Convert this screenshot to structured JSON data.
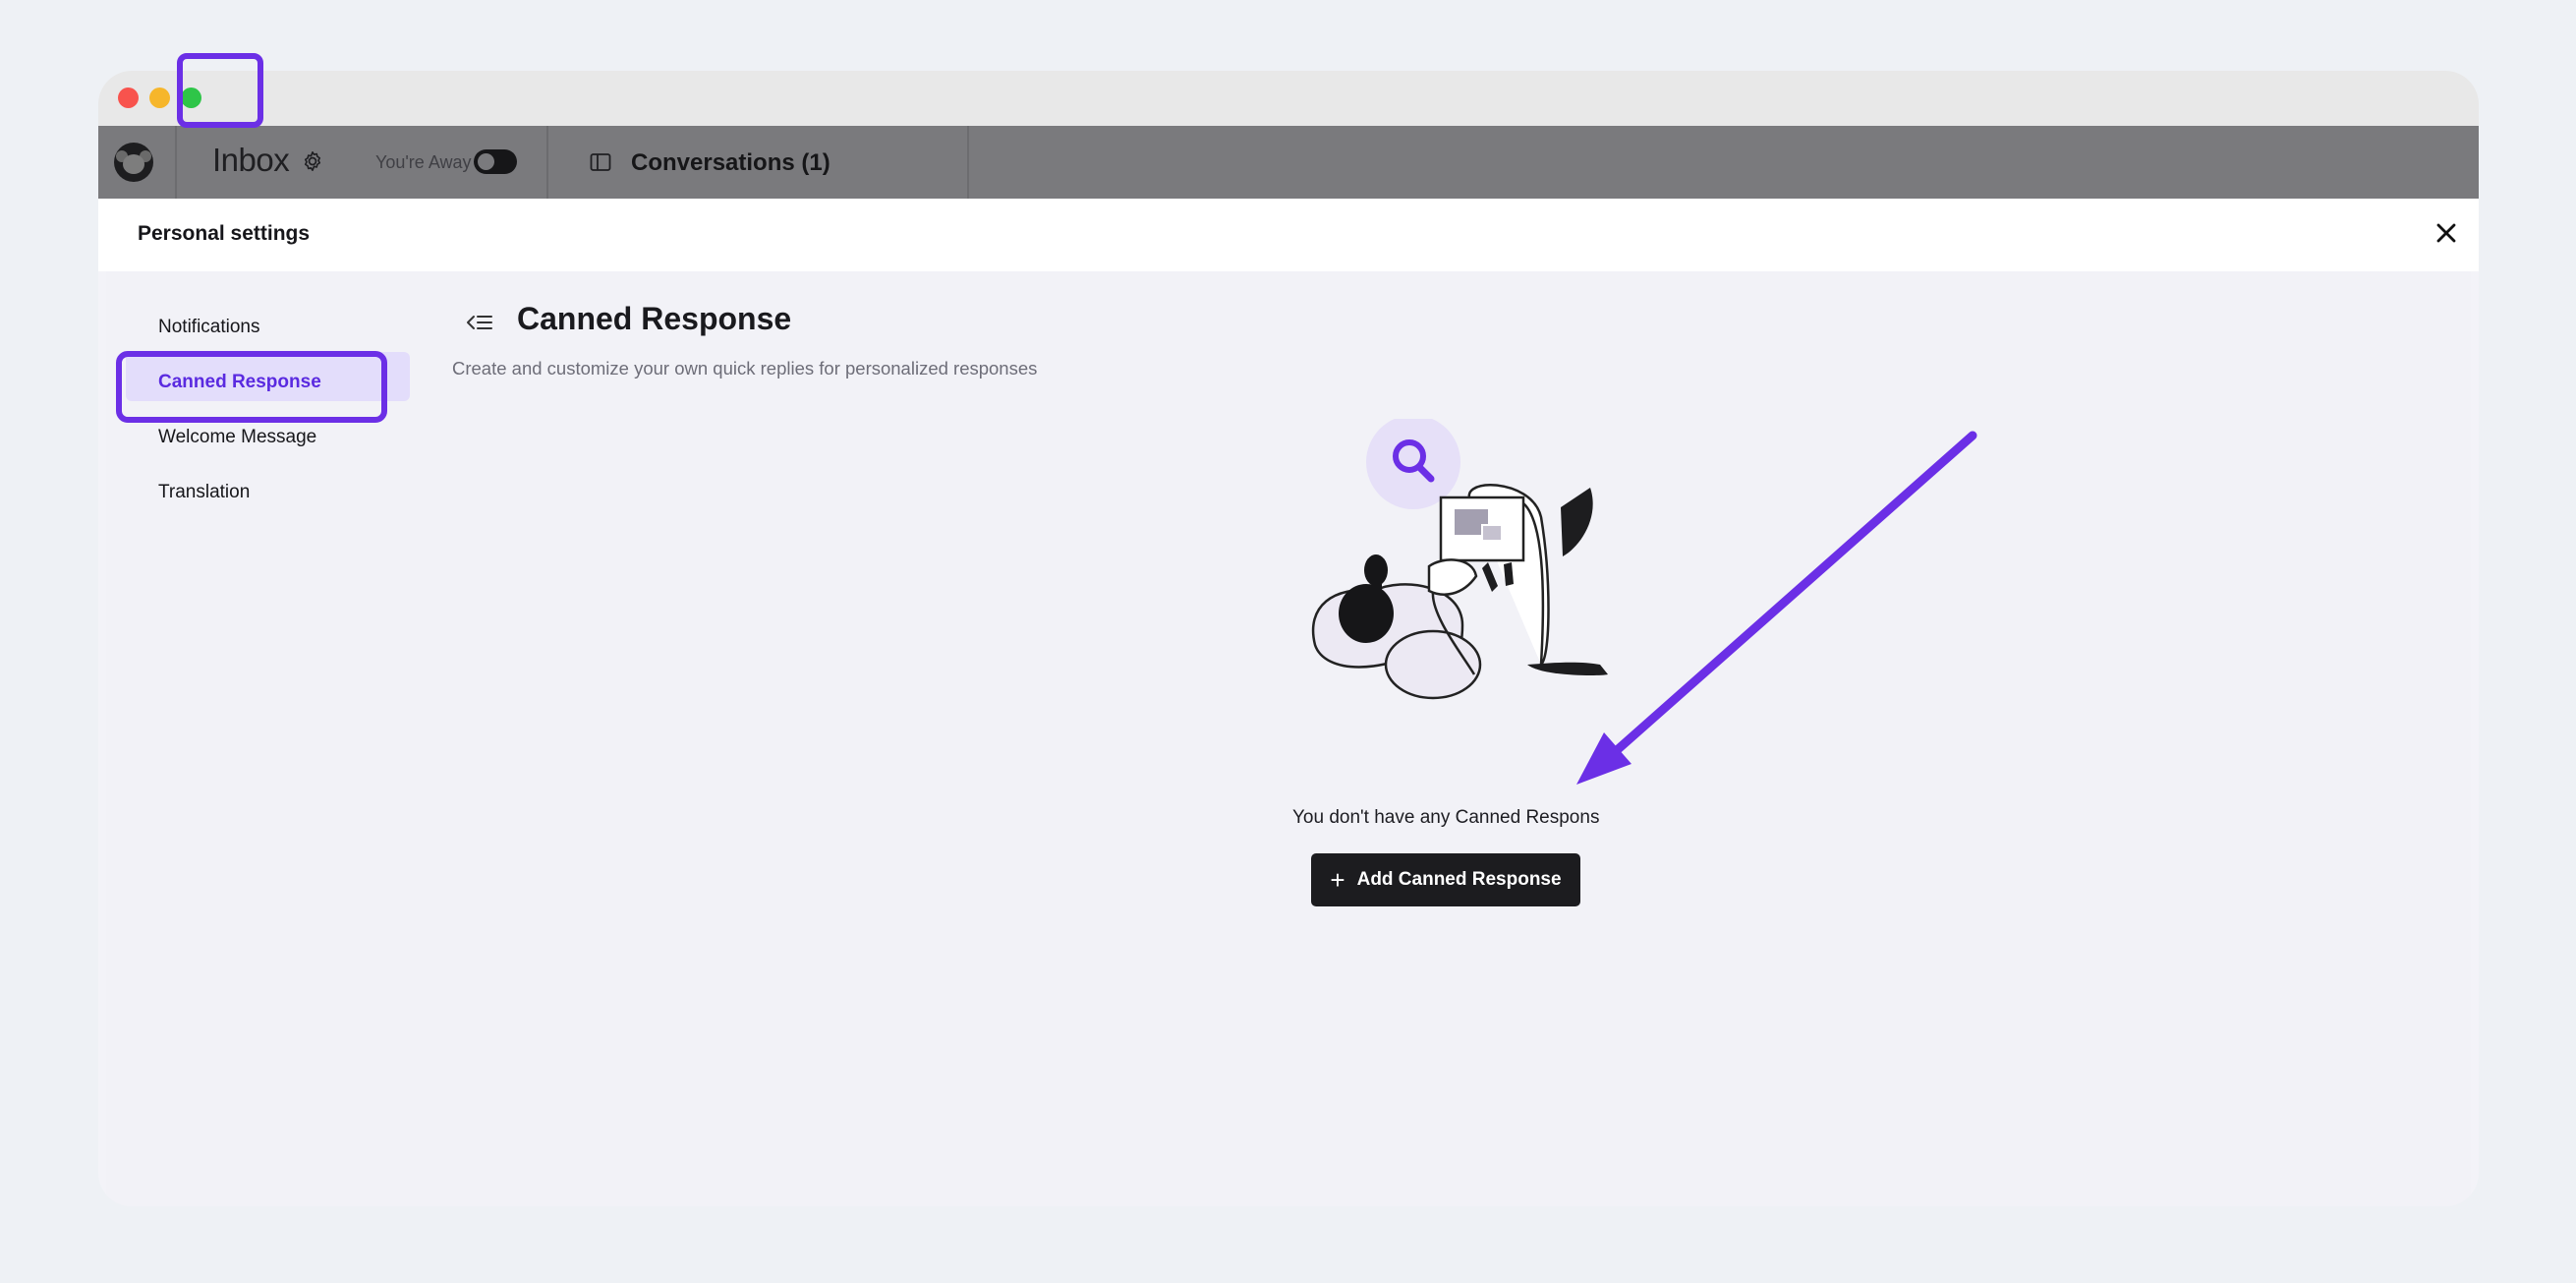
{
  "window": {
    "title_controls": [
      "close",
      "minimize",
      "zoom"
    ]
  },
  "appbar": {
    "logo_icon": "monkey-logo-icon",
    "title": "Inbox",
    "away_label": "You're Away",
    "away_toggle_on": false,
    "conversations_label": "Conversations (1)"
  },
  "settings": {
    "title": "Personal settings",
    "close_icon": "close-icon"
  },
  "nav": {
    "items": [
      {
        "label": "Notifications",
        "active": false
      },
      {
        "label": "Canned Response",
        "active": true
      },
      {
        "label": "Welcome Message",
        "active": false
      },
      {
        "label": "Translation",
        "active": false
      }
    ]
  },
  "main": {
    "title": "Canned Response",
    "subtitle": "Create and customize your own quick replies for personalized responses",
    "empty_text": "You don't have any Canned Respons",
    "add_button_label": "Add Canned Response"
  },
  "annotation": {
    "highlight_color": "#6b2fe6"
  }
}
